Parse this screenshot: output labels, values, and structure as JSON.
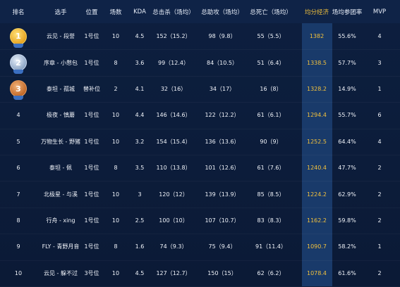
{
  "table": {
    "headers": [
      "排名",
      "选手",
      "位置",
      "场数",
      "KDA",
      "总击杀（场均）",
      "总助攻（场均）",
      "总死亡（场均）",
      "均分经济",
      "场均参团率",
      "MVP"
    ],
    "rows": [
      {
        "rank": "1",
        "medal": "gold-medal-icon",
        "player": "云见 - 段誉",
        "position": "1号位",
        "games": "10",
        "kda": "4.5",
        "kills": "152（15.2）",
        "assists": "98（9.8）",
        "deaths": "55（5.5）",
        "avg_econ": "1382",
        "participation": "55.6%",
        "mvp": "4"
      },
      {
        "rank": "2",
        "medal": "silver-medal-icon",
        "player": "序章 - 小憋包",
        "position": "1号位",
        "games": "8",
        "kda": "3.6",
        "kills": "99（12.4）",
        "assists": "84（10.5）",
        "deaths": "51（6.4）",
        "avg_econ": "1338.5",
        "participation": "57.7%",
        "mvp": "3"
      },
      {
        "rank": "3",
        "medal": "bronze-medal-icon",
        "player": "泰坦 - 孤城",
        "position": "替补位",
        "games": "2",
        "kda": "4.1",
        "kills": "32（16）",
        "assists": "34（17）",
        "deaths": "16（8）",
        "avg_econ": "1328.2",
        "participation": "14.9%",
        "mvp": "1"
      },
      {
        "rank": "4",
        "medal": "",
        "player": "极夜 - 慎蘑",
        "position": "1号位",
        "games": "10",
        "kda": "4.4",
        "kills": "146（14.6）",
        "assists": "122（12.2）",
        "deaths": "61（6.1）",
        "avg_econ": "1294.4",
        "participation": "55.7%",
        "mvp": "6"
      },
      {
        "rank": "5",
        "medal": "",
        "player": "万物生长 - 野猪",
        "position": "1号位",
        "games": "10",
        "kda": "3.2",
        "kills": "154（15.4）",
        "assists": "136（13.6）",
        "deaths": "90（9）",
        "avg_econ": "1252.5",
        "participation": "64.4%",
        "mvp": "4"
      },
      {
        "rank": "6",
        "medal": "",
        "player": "泰坦 - 佩",
        "position": "1号位",
        "games": "8",
        "kda": "3.5",
        "kills": "110（13.8）",
        "assists": "101（12.6）",
        "deaths": "61（7.6）",
        "avg_econ": "1240.4",
        "participation": "47.7%",
        "mvp": "2"
      },
      {
        "rank": "7",
        "medal": "",
        "player": "北极星 - 与溪",
        "position": "1号位",
        "games": "10",
        "kda": "3",
        "kills": "120（12）",
        "assists": "139（13.9）",
        "deaths": "85（8.5）",
        "avg_econ": "1224.2",
        "participation": "62.9%",
        "mvp": "2"
      },
      {
        "rank": "8",
        "medal": "",
        "player": "行舟 - xing",
        "position": "1号位",
        "games": "10",
        "kda": "2.5",
        "kills": "100（10）",
        "assists": "107（10.7）",
        "deaths": "83（8.3）",
        "avg_econ": "1162.2",
        "participation": "59.8%",
        "mvp": "2"
      },
      {
        "rank": "9",
        "medal": "",
        "player": "FLY - 青野月音",
        "position": "1号位",
        "games": "8",
        "kda": "1.6",
        "kills": "74（9.3）",
        "assists": "75（9.4）",
        "deaths": "91（11.4）",
        "avg_econ": "1090.7",
        "participation": "58.2%",
        "mvp": "1"
      },
      {
        "rank": "10",
        "medal": "",
        "player": "云见 - 躲不过",
        "position": "3号位",
        "games": "10",
        "kda": "4.5",
        "kills": "127（12.7）",
        "assists": "150（15）",
        "deaths": "62（6.2）",
        "avg_econ": "1078.4",
        "participation": "61.6%",
        "mvp": "2"
      }
    ]
  },
  "colors": {
    "background": "#0b1a36",
    "header_bg": "#0f2347",
    "highlight_column": "#193a6a",
    "highlight_text": "#f2c13d"
  }
}
